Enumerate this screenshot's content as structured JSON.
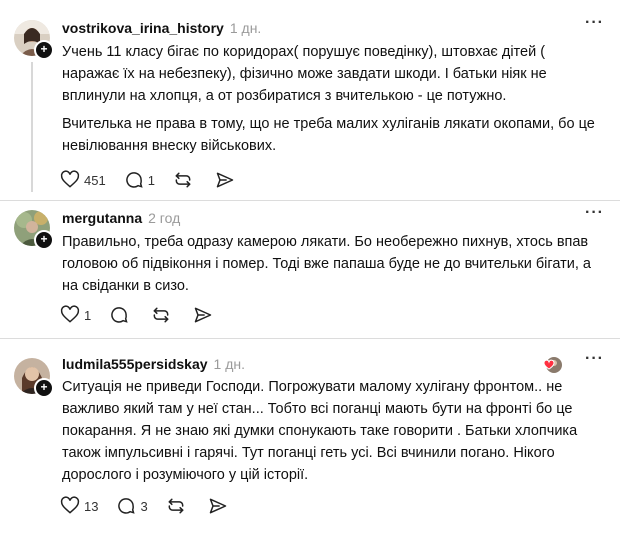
{
  "comments": [
    {
      "username": "vostrikova_irina_history",
      "time": "1 дн.",
      "paragraphs": [
        "Учень 11 класу бігає по коридорах( порушує поведінку), штовхає дітей ( наражає їх на небезпеку), фізично може завдати шкоди. І батьки ніяк не вплинули на хлопця, а от розбиратися з вчителькою - це потужно.",
        "Вчителька не права в тому, що не треба малих хуліганів лякати окопами, бо це невілювання внеску військових."
      ],
      "likes": "451",
      "replies": "1"
    },
    {
      "username": "mergutanna",
      "time": "2 год",
      "paragraphs": [
        "Правильно, треба одразу камерою лякати. Бо необережно пихнув, хтось впав головою об підвіконня і помер. Тоді вже папаша буде не до вчительки бігати, а на свіданки в сизо."
      ],
      "likes": "1",
      "replies": ""
    },
    {
      "username": "ludmila555persidskay",
      "time": "1 дн.",
      "paragraphs": [
        "Ситуація не приведи Господи. Погрожувати малому хулігану фронтом.. не важливо який там у неї стан... Тобто всі поганці мають бути на фронті бо це покарання. Я не знаю які думки спонукають таке говорити . Батьки хлопчика також імпульсивні і гарячі. Тут поганці геть усі. Всі вчинили погано. Нікого дорослого і розуміючого у цій історії."
      ],
      "likes": "13",
      "replies": "3"
    }
  ],
  "icons": {
    "like": "heart-icon",
    "reply": "comment-icon",
    "repost": "repost-icon",
    "share": "share-icon",
    "more": "more-icon",
    "follow": "plus-icon"
  }
}
